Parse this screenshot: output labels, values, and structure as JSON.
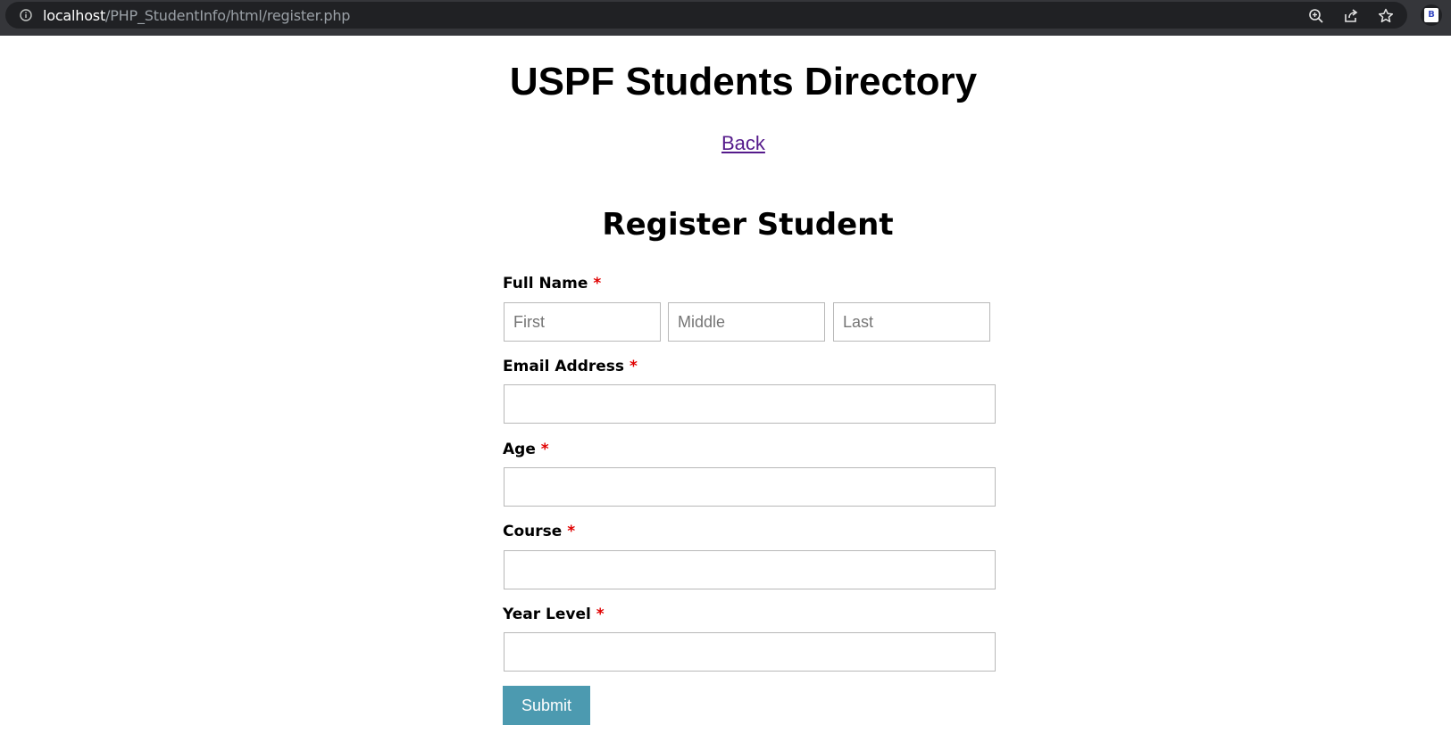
{
  "browser": {
    "url_host": "localhost",
    "url_path": "/PHP_StudentInfo/html/register.php",
    "profile_initial": "B"
  },
  "page": {
    "title": "USPF Students Directory",
    "back_link": "Back"
  },
  "form": {
    "title": "Register Student",
    "required_marker": "*",
    "full_name": {
      "label": "Full Name",
      "first_placeholder": "First",
      "middle_placeholder": "Middle",
      "last_placeholder": "Last"
    },
    "email": {
      "label": "Email Address",
      "value": ""
    },
    "age": {
      "label": "Age",
      "value": ""
    },
    "course": {
      "label": "Course",
      "value": ""
    },
    "year_level": {
      "label": "Year Level",
      "value": ""
    },
    "submit_label": "Submit"
  },
  "colors": {
    "required": "#e00000",
    "submit_bg": "#4c9ab0",
    "link_visited": "#551a8b",
    "browser_bar": "#35363a"
  }
}
